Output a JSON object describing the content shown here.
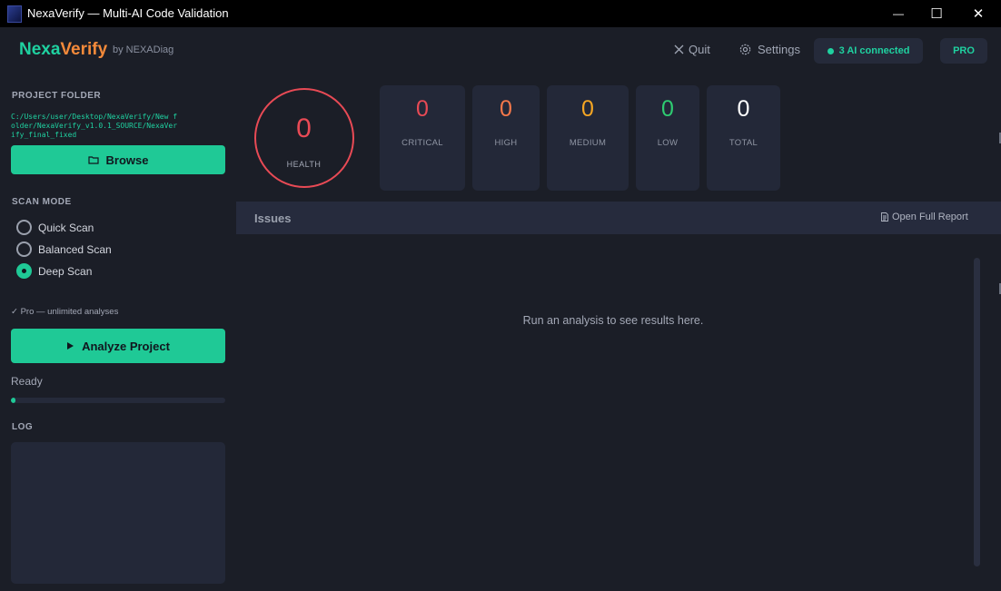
{
  "window": {
    "title": "NexaVerify — Multi-AI Code Validation",
    "minimize_symbol": "—",
    "maximize_symbol": "☐",
    "close_symbol": "✕"
  },
  "header": {
    "brand_part1": "Nexa",
    "brand_part2": "Verify",
    "brand_sub": "by NEXADiag",
    "quit_label": "Quit",
    "quit_icon": "close-icon",
    "settings_label": "Settings",
    "settings_icon": "gear-icon",
    "ai_status": "3 AI connected",
    "plan_badge": "PRO"
  },
  "sidebar": {
    "project_folder_label": "PROJECT FOLDER",
    "project_path": "C:/Users/user/Desktop/NexaVerify/New folder/NexaVerify_v1.0.1_SOURCE/NexaVerify_final_fixed",
    "browse_label": "Browse",
    "browse_icon": "folder-icon",
    "scan_mode_label": "SCAN MODE",
    "scan_modes": [
      {
        "label": "Quick Scan",
        "selected": false
      },
      {
        "label": "Balanced Scan",
        "selected": false
      },
      {
        "label": "Deep Scan",
        "selected": true
      }
    ],
    "pro_note": "✓ Pro — unlimited analyses",
    "analyze_label": "Analyze Project",
    "analyze_icon": "play-icon",
    "status": "Ready",
    "progress": 0.02,
    "log_label": "LOG",
    "log_content": ""
  },
  "summary": {
    "health_value": "0",
    "health_label": "HEALTH",
    "stats": [
      {
        "value": "0",
        "label": "CRITICAL",
        "color": "#e84a55"
      },
      {
        "value": "0",
        "label": "HIGH",
        "color": "#f5784a"
      },
      {
        "value": "0",
        "label": "MEDIUM",
        "color": "#f5a623"
      },
      {
        "value": "0",
        "label": "LOW",
        "color": "#2ecc71"
      },
      {
        "value": "0",
        "label": "TOTAL",
        "color": "#ffffff"
      }
    ]
  },
  "issues": {
    "title": "Issues",
    "report_link": "Open Full Report",
    "report_icon": "document-icon",
    "empty_message": "Run an analysis to see results here."
  },
  "colors": {
    "accent": "#1fc996",
    "brand_orange": "#f58a3a",
    "health": "#e84a55",
    "background": "#1b1e27",
    "card": "#232838"
  }
}
